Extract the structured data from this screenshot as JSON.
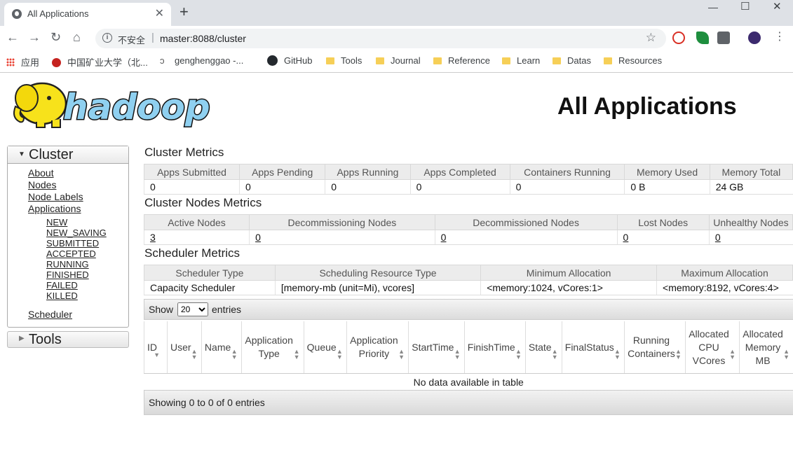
{
  "browser": {
    "tab_title": "All Applications",
    "tab_close": "✕",
    "new_tab": "+",
    "security_label": "不安全",
    "url": "master:8088/cluster",
    "bookmarks": [
      {
        "label": "应用",
        "icon": "apps-grid-icon"
      },
      {
        "label": "中国矿业大学（北...",
        "icon": "cumt-logo-icon"
      },
      {
        "label": "genghenggao -...",
        "icon": "user-link-icon"
      },
      {
        "label": "GitHub",
        "icon": "github-icon"
      },
      {
        "label": "Tools",
        "icon": "folder-icon"
      },
      {
        "label": "Journal",
        "icon": "folder-icon"
      },
      {
        "label": "Reference",
        "icon": "folder-icon"
      },
      {
        "label": "Learn",
        "icon": "folder-icon"
      },
      {
        "label": "Datas",
        "icon": "folder-icon"
      },
      {
        "label": "Resources",
        "icon": "folder-icon"
      }
    ]
  },
  "page": {
    "title": "All Applications",
    "logo_text": "hadoop"
  },
  "sidebar": {
    "cluster_label": "Cluster",
    "links": [
      "About",
      "Nodes",
      "Node Labels",
      "Applications"
    ],
    "app_states": [
      "NEW",
      "NEW_SAVING",
      "SUBMITTED",
      "ACCEPTED",
      "RUNNING",
      "FINISHED",
      "FAILED",
      "KILLED"
    ],
    "scheduler_label": "Scheduler",
    "tools_label": "Tools"
  },
  "cluster_metrics": {
    "title": "Cluster Metrics",
    "headers": [
      "Apps Submitted",
      "Apps Pending",
      "Apps Running",
      "Apps Completed",
      "Containers Running",
      "Memory Used",
      "Memory Total"
    ],
    "values": [
      "0",
      "0",
      "0",
      "0",
      "0",
      "0 B",
      "24 GB"
    ]
  },
  "nodes_metrics": {
    "title": "Cluster Nodes Metrics",
    "headers": [
      "Active Nodes",
      "Decommissioning Nodes",
      "Decommissioned Nodes",
      "Lost Nodes",
      "Unhealthy Nodes"
    ],
    "values": [
      "3",
      "0",
      "0",
      "0",
      "0"
    ]
  },
  "scheduler_metrics": {
    "title": "Scheduler Metrics",
    "headers": [
      "Scheduler Type",
      "Scheduling Resource Type",
      "Minimum Allocation",
      "Maximum Allocation"
    ],
    "values": [
      "Capacity Scheduler",
      "[memory-mb (unit=Mi), vcores]",
      "<memory:1024, vCores:1>",
      "<memory:8192, vCores:4>"
    ]
  },
  "apps_table": {
    "show_label": "Show",
    "page_size": "20",
    "entries_label": "entries",
    "columns": [
      "ID",
      "User",
      "Name",
      "Application Type",
      "Queue",
      "Application Priority",
      "StartTime",
      "FinishTime",
      "State",
      "FinalStatus",
      "Running Containers",
      "Allocated CPU VCores",
      "Allocated Memory MB"
    ],
    "empty_text": "No data available in table",
    "footer_text": "Showing 0 to 0 of 0 entries"
  }
}
